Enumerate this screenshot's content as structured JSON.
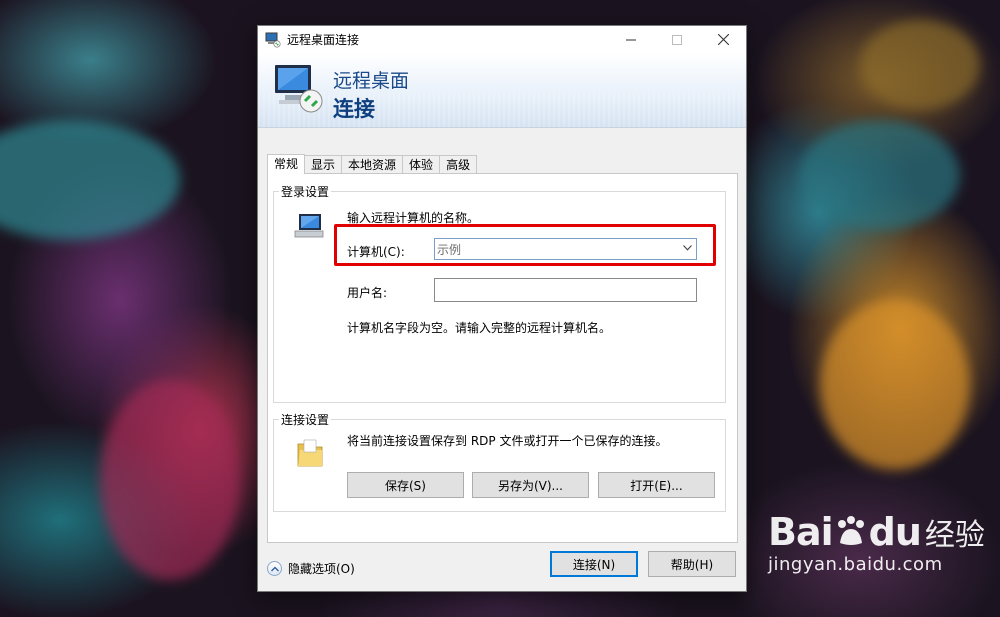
{
  "window": {
    "title": "远程桌面连接",
    "banner_line1": "远程桌面",
    "banner_line2": "连接"
  },
  "tabs": [
    {
      "label": "常规",
      "active": true
    },
    {
      "label": "显示",
      "active": false
    },
    {
      "label": "本地资源",
      "active": false
    },
    {
      "label": "体验",
      "active": false
    },
    {
      "label": "高级",
      "active": false
    }
  ],
  "login": {
    "group_title": "登录设置",
    "instruction": "输入远程计算机的名称。",
    "computer_label": "计算机(C):",
    "computer_value": "示例",
    "username_label": "用户名:",
    "username_value": "",
    "warning": "计算机名字段为空。请输入完整的远程计算机名。"
  },
  "connection": {
    "group_title": "连接设置",
    "description": "将当前连接设置保存到 RDP 文件或打开一个已保存的连接。",
    "save_label": "保存(S)",
    "save_as_label": "另存为(V)...",
    "open_label": "打开(E)..."
  },
  "footer": {
    "hide_options_label": "隐藏选项(O)",
    "connect_label": "连接(N)",
    "help_label": "帮助(H)"
  },
  "watermark": {
    "logo": "Bai",
    "logo_suffix": "du",
    "sub": "经验",
    "url": "jingyan.baidu.com"
  },
  "colors": {
    "highlight": "#e00000",
    "banner_text": "#0d3f7f",
    "primary_border": "#0078d7"
  }
}
